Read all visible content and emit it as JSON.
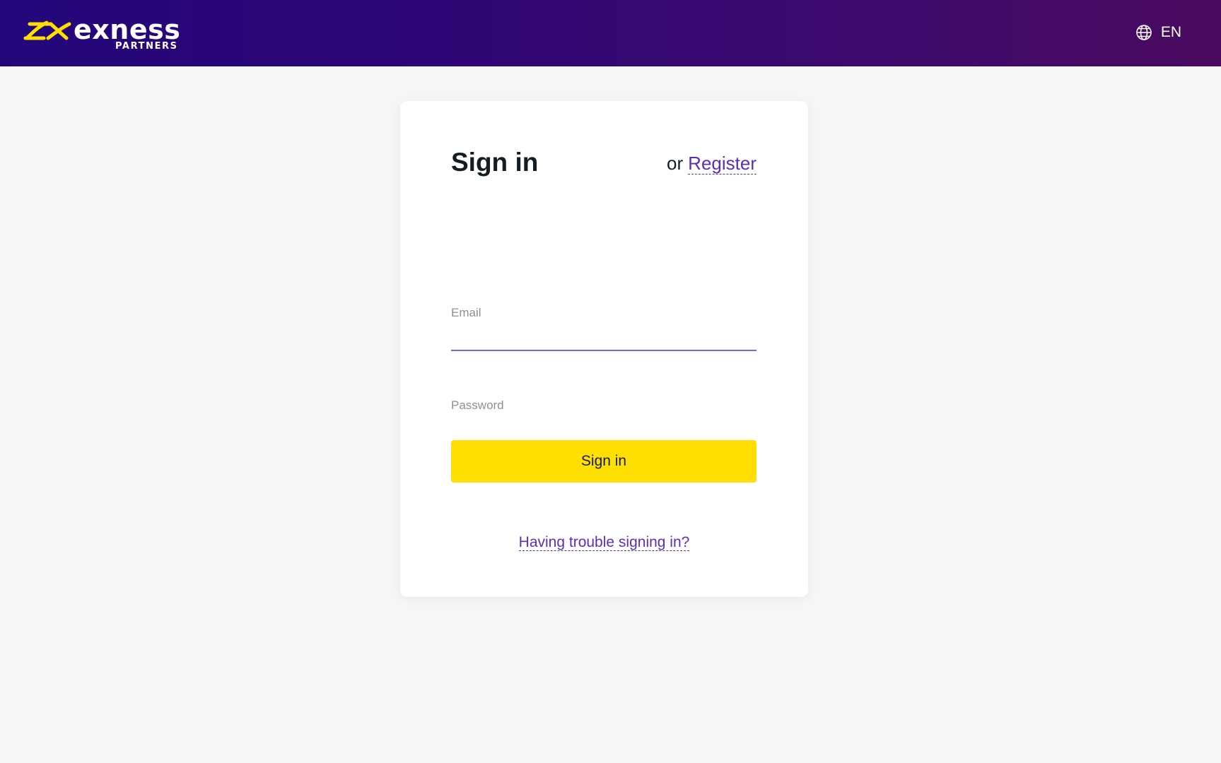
{
  "header": {
    "brand": "exness",
    "brand_sub": "PARTNERS",
    "language": "EN",
    "language_icon": "globe-icon"
  },
  "signin": {
    "title": "Sign in",
    "or_text": "or",
    "register_link": "Register",
    "email_label": "Email",
    "email_value": "",
    "password_label": "Password",
    "password_value": "",
    "submit_label": "Sign in",
    "trouble_link": "Having trouble signing in?"
  },
  "colors": {
    "header_gradient_start": "#23077a",
    "header_gradient_end": "#4a0a5e",
    "logo_mark": "#ffde02",
    "primary_button": "#ffde02",
    "link": "#5b2fb8",
    "page_background": "#f4f7f4"
  }
}
